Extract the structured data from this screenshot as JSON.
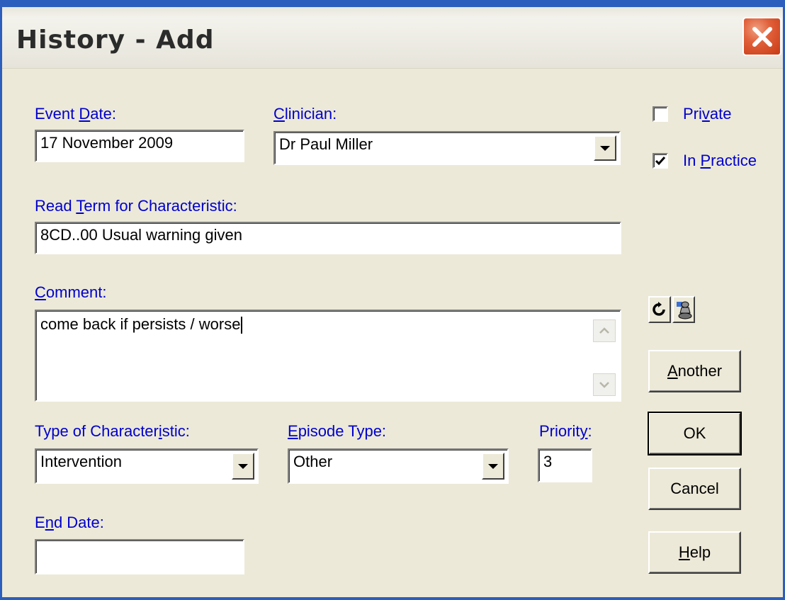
{
  "window": {
    "title": "History - Add"
  },
  "labels": {
    "event_date": "Event Date:",
    "clinician": "Clinician:",
    "read_term": "Read Term for Characteristic:",
    "comment": "Comment:",
    "type_of_characteristic": "Type of Characteristic:",
    "episode_type": "Episode Type:",
    "priority": "Priority:",
    "end_date": "End Date:"
  },
  "fields": {
    "event_date": "17 November 2009",
    "clinician": "Dr Paul Miller",
    "read_term": "8CD..00 Usual warning given",
    "comment": "come back if persists / worse",
    "type_of_characteristic": "Intervention",
    "episode_type": "Other",
    "priority": "3",
    "end_date": ""
  },
  "checkboxes": {
    "private": {
      "label": "Private",
      "checked": false
    },
    "in_practice": {
      "label": "In Practice",
      "checked": true
    }
  },
  "buttons": {
    "another": "Another",
    "ok": "OK",
    "cancel": "Cancel",
    "help": "Help"
  },
  "colors": {
    "label": "#0000cc",
    "window_bg": "#ece9d8",
    "close": "#d04a22",
    "frame": "#2b5ebd"
  }
}
